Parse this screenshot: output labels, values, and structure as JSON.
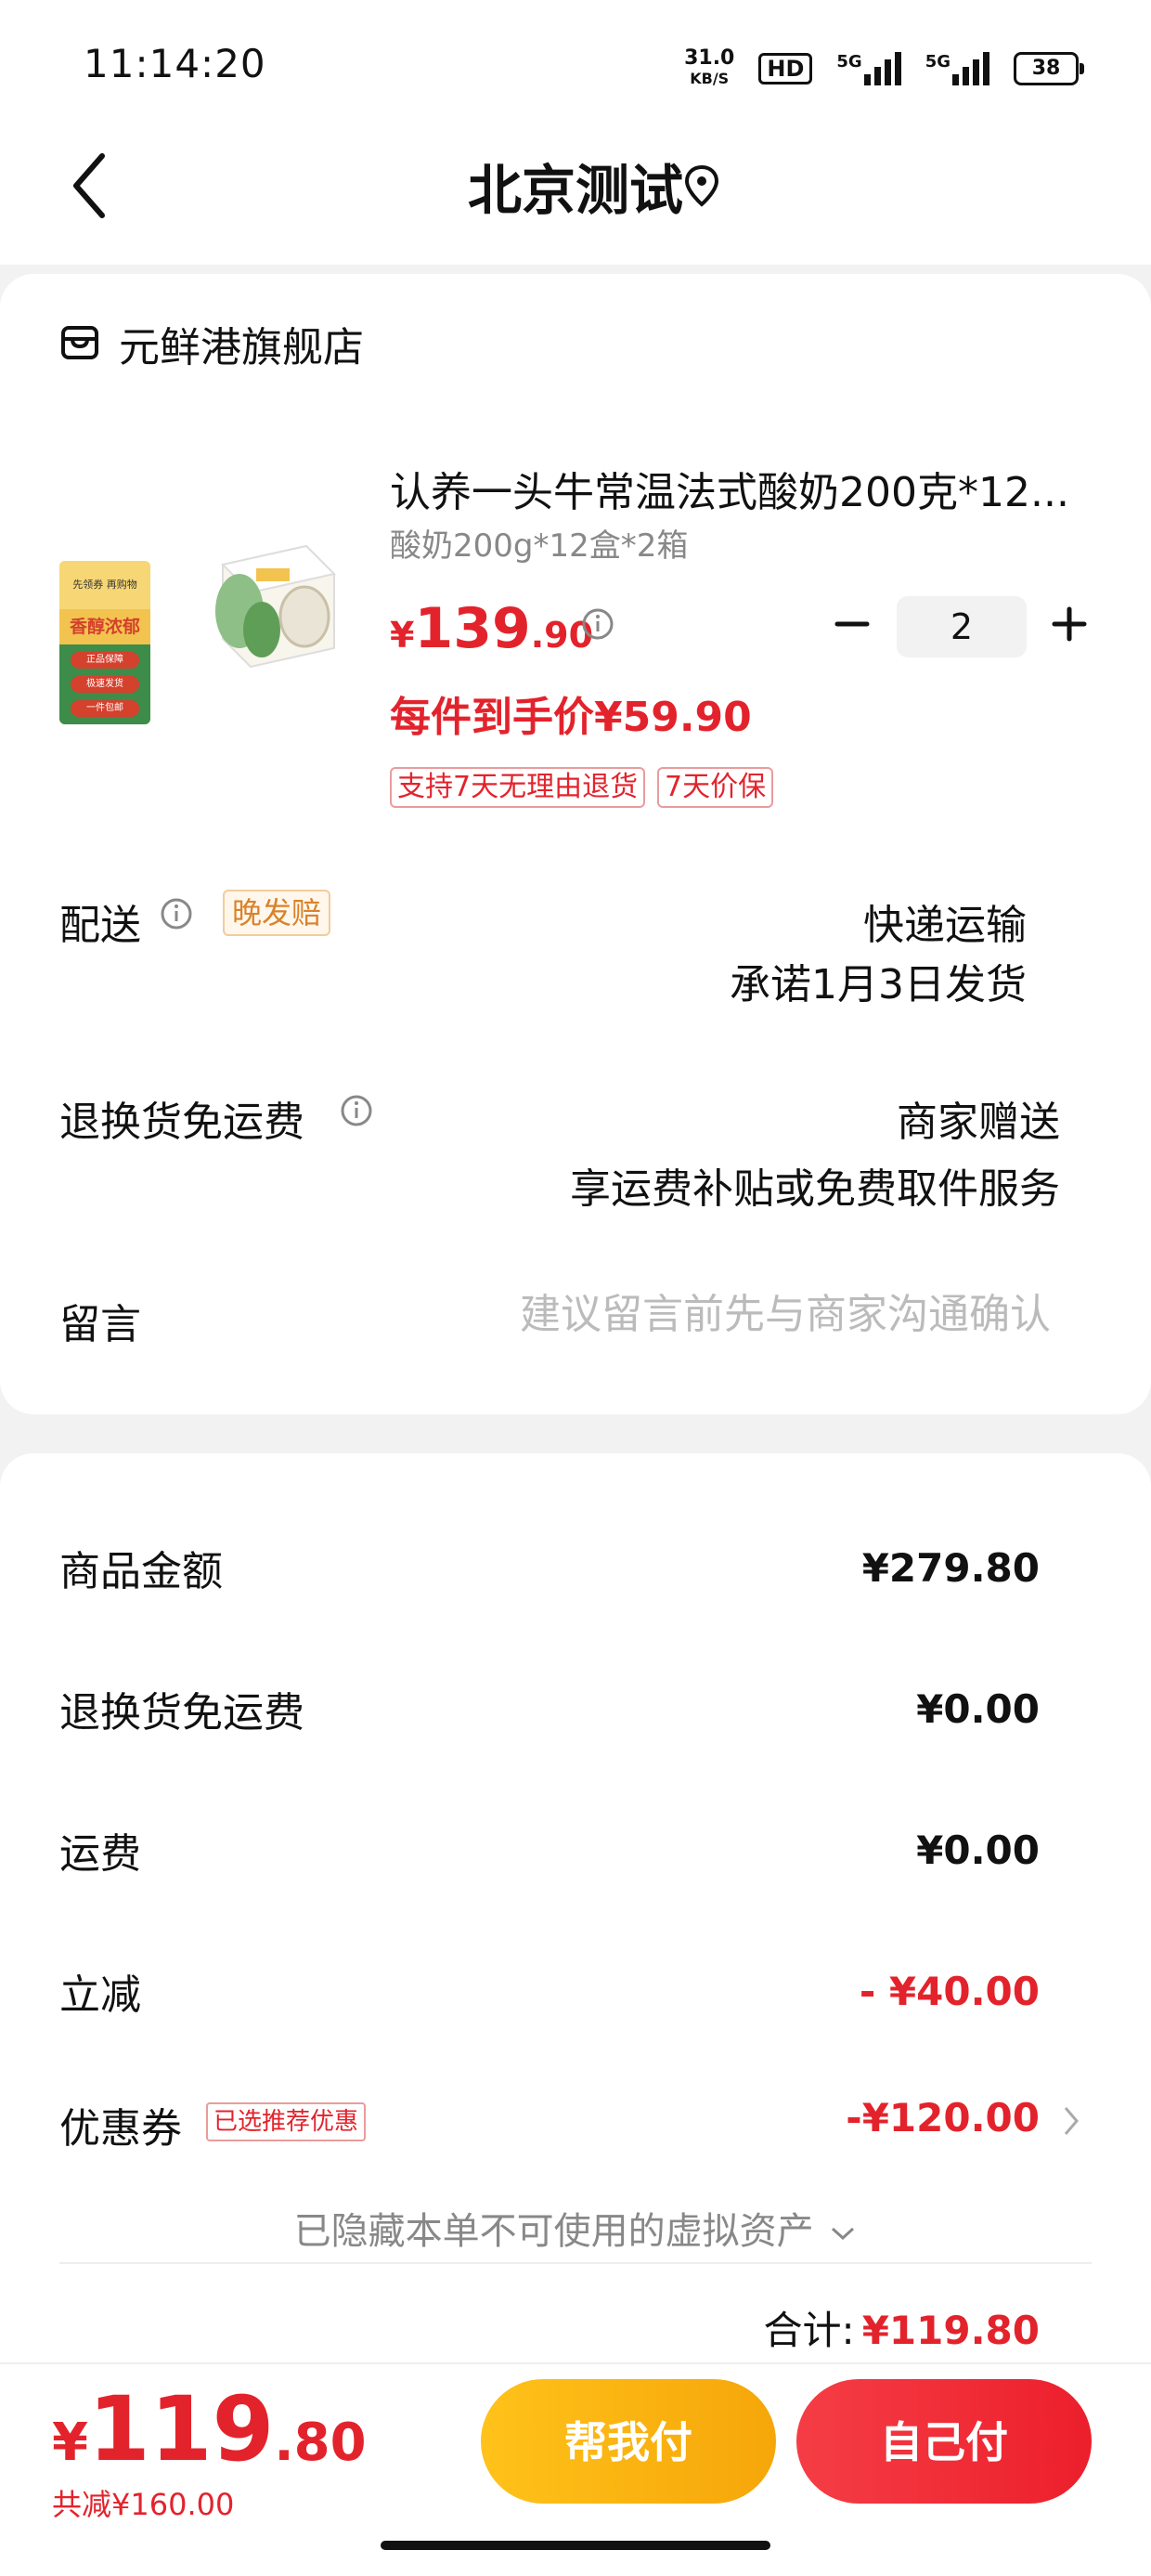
{
  "status": {
    "time": "11:14:20",
    "net_speed_value": "31.0",
    "net_speed_unit": "KB/S",
    "hd_label": "HD",
    "sig1_label": "5G",
    "sig2_label": "5G",
    "battery": "38"
  },
  "header": {
    "title": "北京测试",
    "back_icon": "chevron-left-icon",
    "location_icon": "location-pin-icon"
  },
  "store": {
    "name": "元鲜港旗舰店",
    "icon": "store-icon"
  },
  "product": {
    "title": "认养一头牛常温法式酸奶200克*12...",
    "spec": "酸奶200g*12盒*2箱",
    "price_currency": "¥",
    "price_int": "139",
    "price_dec": ".90",
    "quantity": "2",
    "unit_price": "每件到手价¥59.90",
    "tags": [
      "支持7天无理由退货",
      "7天价保"
    ],
    "image_text": {
      "top": "先领券 再购物",
      "mid": "香醇浓郁",
      "pills": [
        "正品保障",
        "极速发货",
        "一件包邮"
      ]
    }
  },
  "delivery": {
    "label": "配送",
    "badge": "晚发赔",
    "value1": "快递运输",
    "value2": "承诺1月3日发货"
  },
  "return_shipping": {
    "label": "退换货免运费",
    "value1": "商家赠送",
    "value2": "享运费补贴或免费取件服务"
  },
  "message": {
    "label": "留言",
    "placeholder": "建议留言前先与商家沟通确认"
  },
  "summary": {
    "goods_label": "商品金额",
    "goods_value": "¥279.80",
    "return_label": "退换货免运费",
    "return_value": "¥0.00",
    "shipping_label": "运费",
    "shipping_value": "¥0.00",
    "discount_label": "立减",
    "discount_value": "- ¥40.00",
    "coupon_label": "优惠券",
    "coupon_badge": "已选推荐优惠",
    "coupon_value": "-¥120.00",
    "hidden_note": "已隐藏本单不可使用的虚拟资产",
    "total_label": "合计:",
    "total_value": "¥119.80"
  },
  "footer": {
    "price_currency": "¥",
    "price_int": "119",
    "price_dec": ".80",
    "saved": "共减¥160.00",
    "help_pay": "帮我付",
    "self_pay": "自己付"
  },
  "colors": {
    "accent_red": "#e3232c",
    "help_button": "#f6a609",
    "self_button": "#ec1f2b"
  }
}
